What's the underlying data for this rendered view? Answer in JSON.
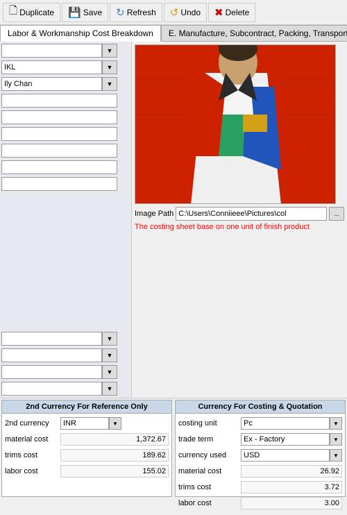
{
  "toolbar": {
    "duplicate_label": "Duplicate",
    "save_label": "Save",
    "refresh_label": "Refresh",
    "undo_label": "Undo",
    "delete_label": "Delete"
  },
  "tabs": {
    "tab1_label": "Labor & Workmanship Cost Breakdown",
    "tab2_label": "E. Manufacture, Subcontract, Packing, Transport,"
  },
  "left_panel": {
    "field1_value": "IKL",
    "field2_value": "Ily Chan"
  },
  "right_panel": {
    "image_path_label": "Image Path",
    "image_path_value": "C:\\Users\\Conniieee\\Pictures\\col",
    "costing_note": "The costing sheet base on one unit of finish product"
  },
  "currency_panel": {
    "header": "2nd Currency For Reference Only",
    "currency_label": "2nd currency",
    "currency_value": "INR",
    "material_cost_label": "material cost",
    "material_cost_value": "1,372.67",
    "trims_cost_label": "trims cost",
    "trims_cost_value": "189.62",
    "labor_cost_label": "labor cost",
    "labor_cost_value": "155.02"
  },
  "costing_panel": {
    "header": "Currency For Costing & Quotation",
    "costing_unit_label": "costing unit",
    "costing_unit_value": "Pc",
    "trade_term_label": "trade term",
    "trade_term_value": "Ex - Factory",
    "currency_used_label": "currency used",
    "currency_used_value": "USD",
    "material_cost_label": "material cost",
    "material_cost_value": "26.92",
    "trims_cost_label": "trims cost",
    "trims_cost_value": "3.72",
    "labor_cost_label": "labor cost",
    "labor_cost_value": "3.00"
  }
}
